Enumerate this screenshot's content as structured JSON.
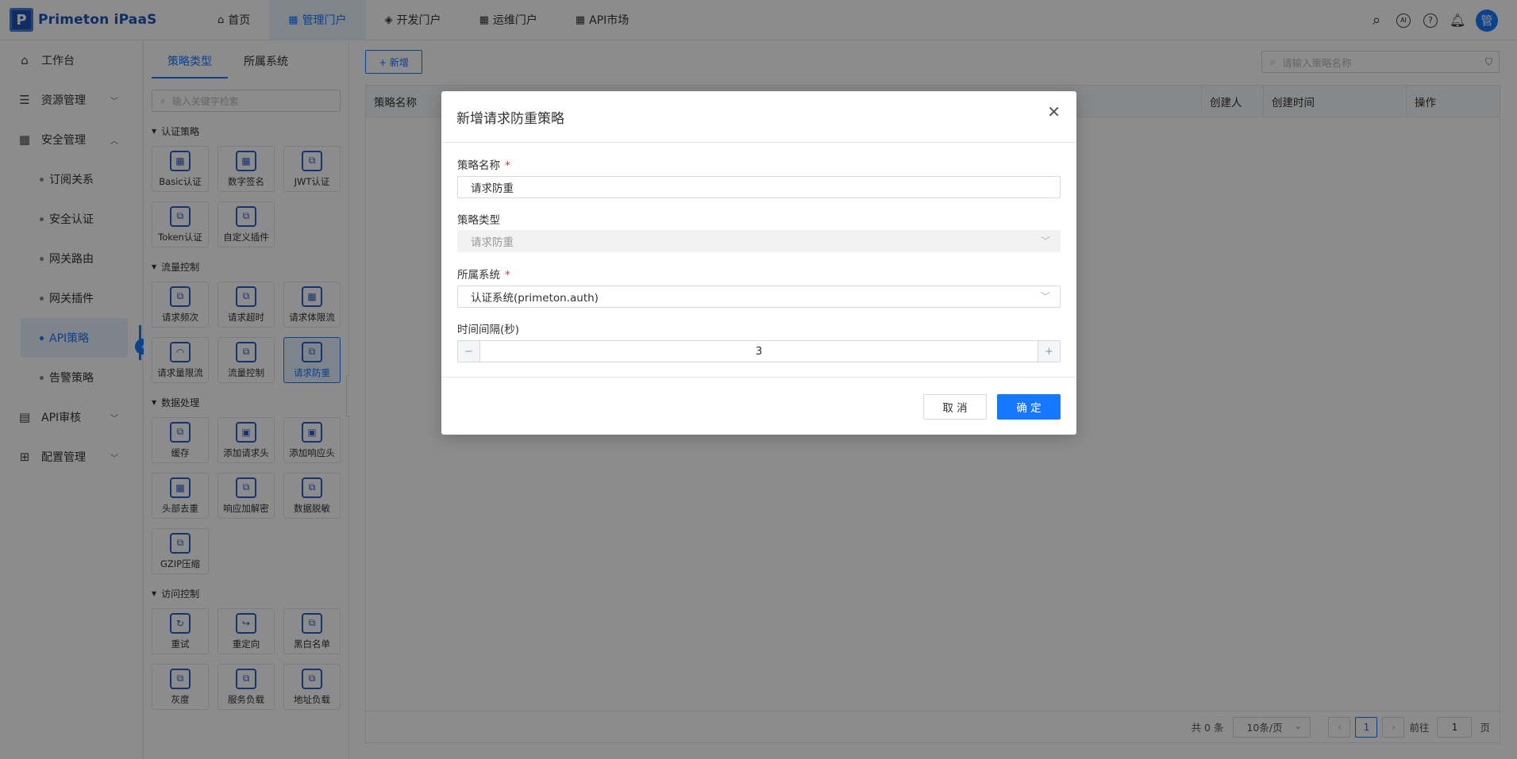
{
  "app": {
    "name": "Primeton iPaaS",
    "logo_letter": "P"
  },
  "nav": [
    {
      "label": "首页",
      "icon": "home-icon"
    },
    {
      "label": "管理门户",
      "icon": "grid-icon"
    },
    {
      "label": "开发门户",
      "icon": "layers-icon"
    },
    {
      "label": "运维门户",
      "icon": "grid-icon"
    },
    {
      "label": "API市场",
      "icon": "grid-icon"
    }
  ],
  "user": {
    "avatar_text": "管"
  },
  "sidebar": {
    "items": [
      {
        "label": "工作台"
      },
      {
        "label": "资源管理"
      },
      {
        "label": "安全管理"
      },
      {
        "label": "订阅关系"
      },
      {
        "label": "安全认证"
      },
      {
        "label": "网关路由"
      },
      {
        "label": "网关插件"
      },
      {
        "label": "API策略"
      },
      {
        "label": "告警策略"
      },
      {
        "label": "API审核"
      },
      {
        "label": "配置管理"
      }
    ]
  },
  "mid": {
    "tabs": [
      "策略类型",
      "所属系统"
    ],
    "search_placeholder": "输入关键字检索",
    "groups": [
      {
        "title": "认证策略",
        "items": [
          "Basic认证",
          "数字签名",
          "JWT认证",
          "Token认证",
          "自定义插件"
        ]
      },
      {
        "title": "流量控制",
        "items": [
          "请求频次",
          "请求超时",
          "请求体限流",
          "请求量限流",
          "流量控制",
          "请求防重"
        ]
      },
      {
        "title": "数据处理",
        "items": [
          "缓存",
          "添加请求头",
          "添加响应头",
          "头部去重",
          "响应加解密",
          "数据脱敏",
          "GZIP压缩"
        ]
      },
      {
        "title": "访问控制",
        "items": [
          "重试",
          "重定向",
          "黑白名单",
          "灰度",
          "服务负载",
          "地址负载"
        ]
      }
    ]
  },
  "main": {
    "add_label": "+ 新增",
    "search_placeholder": "请输入策略名称",
    "columns": [
      "策略名称",
      "创建人",
      "创建时间",
      "操作"
    ],
    "pager": {
      "total": "共 0 条",
      "page_size": "10条/页",
      "current": "1",
      "goto_label": "前往",
      "goto_value": "1",
      "page_suffix": "页"
    }
  },
  "modal": {
    "title": "新增请求防重策略",
    "fields": {
      "name_label": "策略名称",
      "name_value": "请求防重",
      "type_label": "策略类型",
      "type_value": "请求防重",
      "system_label": "所属系统",
      "system_value": "认证系统(primeton.auth)",
      "interval_label": "时间间隔(秒)",
      "interval_value": "3"
    },
    "cancel_label": "取 消",
    "ok_label": "确 定"
  },
  "colors": {
    "primary": "#1677ff",
    "logo": "#1a55b8",
    "required": "#f5222d"
  }
}
